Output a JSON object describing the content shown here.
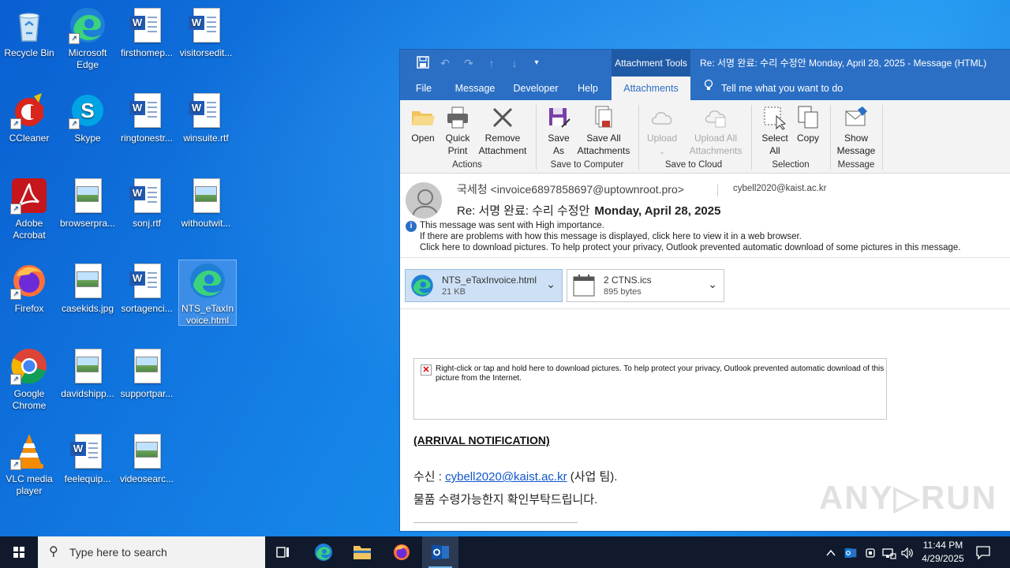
{
  "desktop": {
    "icons": [
      {
        "label": "Recycle Bin"
      },
      {
        "label": "Microsoft Edge"
      },
      {
        "label": "firsthomep..."
      },
      {
        "label": "visitorsedit..."
      },
      {
        "label": "CCleaner"
      },
      {
        "label": "Skype"
      },
      {
        "label": "ringtonestr..."
      },
      {
        "label": "winsuite.rtf"
      },
      {
        "label": "Adobe Acrobat"
      },
      {
        "label": "browserpra..."
      },
      {
        "label": "sonj.rtf"
      },
      {
        "label": "withoutwit..."
      },
      {
        "label": "Firefox"
      },
      {
        "label": "casekids.jpg"
      },
      {
        "label": "sortagenci..."
      },
      {
        "label": "NTS_eTaxInvoice.html"
      },
      {
        "label": "Google Chrome"
      },
      {
        "label": "davidshipp..."
      },
      {
        "label": "supportpar..."
      },
      {
        "label": "VLC media player"
      },
      {
        "label": "feelequip..."
      },
      {
        "label": "videosearc..."
      }
    ]
  },
  "outlook": {
    "context_tab": "Attachment Tools",
    "title": "Re: 서명 완료: 수리 수정안  Monday, April 28, 2025  -  Message (HTML)",
    "tabs": [
      {
        "label": "File"
      },
      {
        "label": "Message"
      },
      {
        "label": "Developer"
      },
      {
        "label": "Help"
      },
      {
        "label": "Attachments"
      }
    ],
    "tell_me": "Tell me what you want to do",
    "ribbon": {
      "open": "Open",
      "quick_print_1": "Quick",
      "quick_print_2": "Print",
      "remove_1": "Remove",
      "remove_2": "Attachment",
      "group_actions": "Actions",
      "save_as_1": "Save",
      "save_as_2": "As",
      "save_all_1": "Save All",
      "save_all_2": "Attachments",
      "group_save_computer": "Save to Computer",
      "upload": "Upload",
      "upload_all_1": "Upload All",
      "upload_all_2": "Attachments",
      "group_save_cloud": "Save to Cloud",
      "select_all_1": "Select",
      "select_all_2": "All",
      "copy": "Copy",
      "group_selection": "Selection",
      "show_msg_1": "Show",
      "show_msg_2": "Message",
      "group_message": "Message"
    },
    "message": {
      "from": "국세청 <invoice6897858697@uptownroot.pro>",
      "to": "cybell2020@kaist.ac.kr",
      "subject": "Re: 서명 완료: 수리 수정안",
      "date": "Monday, April 28, 2025",
      "info_1": "This message was sent with High importance.",
      "info_2": "If there are problems with how this message is displayed, click here to view it in a web browser.",
      "info_3": "Click here to download pictures. To help protect your privacy, Outlook prevented automatic download of some pictures in this message."
    },
    "attachments": [
      {
        "name": "NTS_eTaxInvoice.html",
        "size": "21 KB"
      },
      {
        "name": "2  CTNS.ics",
        "size": "895 bytes"
      }
    ],
    "body": {
      "blocked_text": "Right-click or tap and hold here to download pictures. To help protect your privacy, Outlook prevented automatic download of this picture from the Internet.",
      "arrival": "(ARRIVAL NOTIFICATION)",
      "recipient_prefix": "수신 : ",
      "recipient_email": "cybell2020@kaist.ac.kr",
      "recipient_suffix": " (사업 팀).",
      "confirm": "물품 수령가능한지 확인부탁드립니다."
    }
  },
  "watermark": "ANY▷RUN",
  "taskbar": {
    "search_placeholder": "Type here to search",
    "time": "11:44 PM",
    "date": "4/29/2025"
  }
}
